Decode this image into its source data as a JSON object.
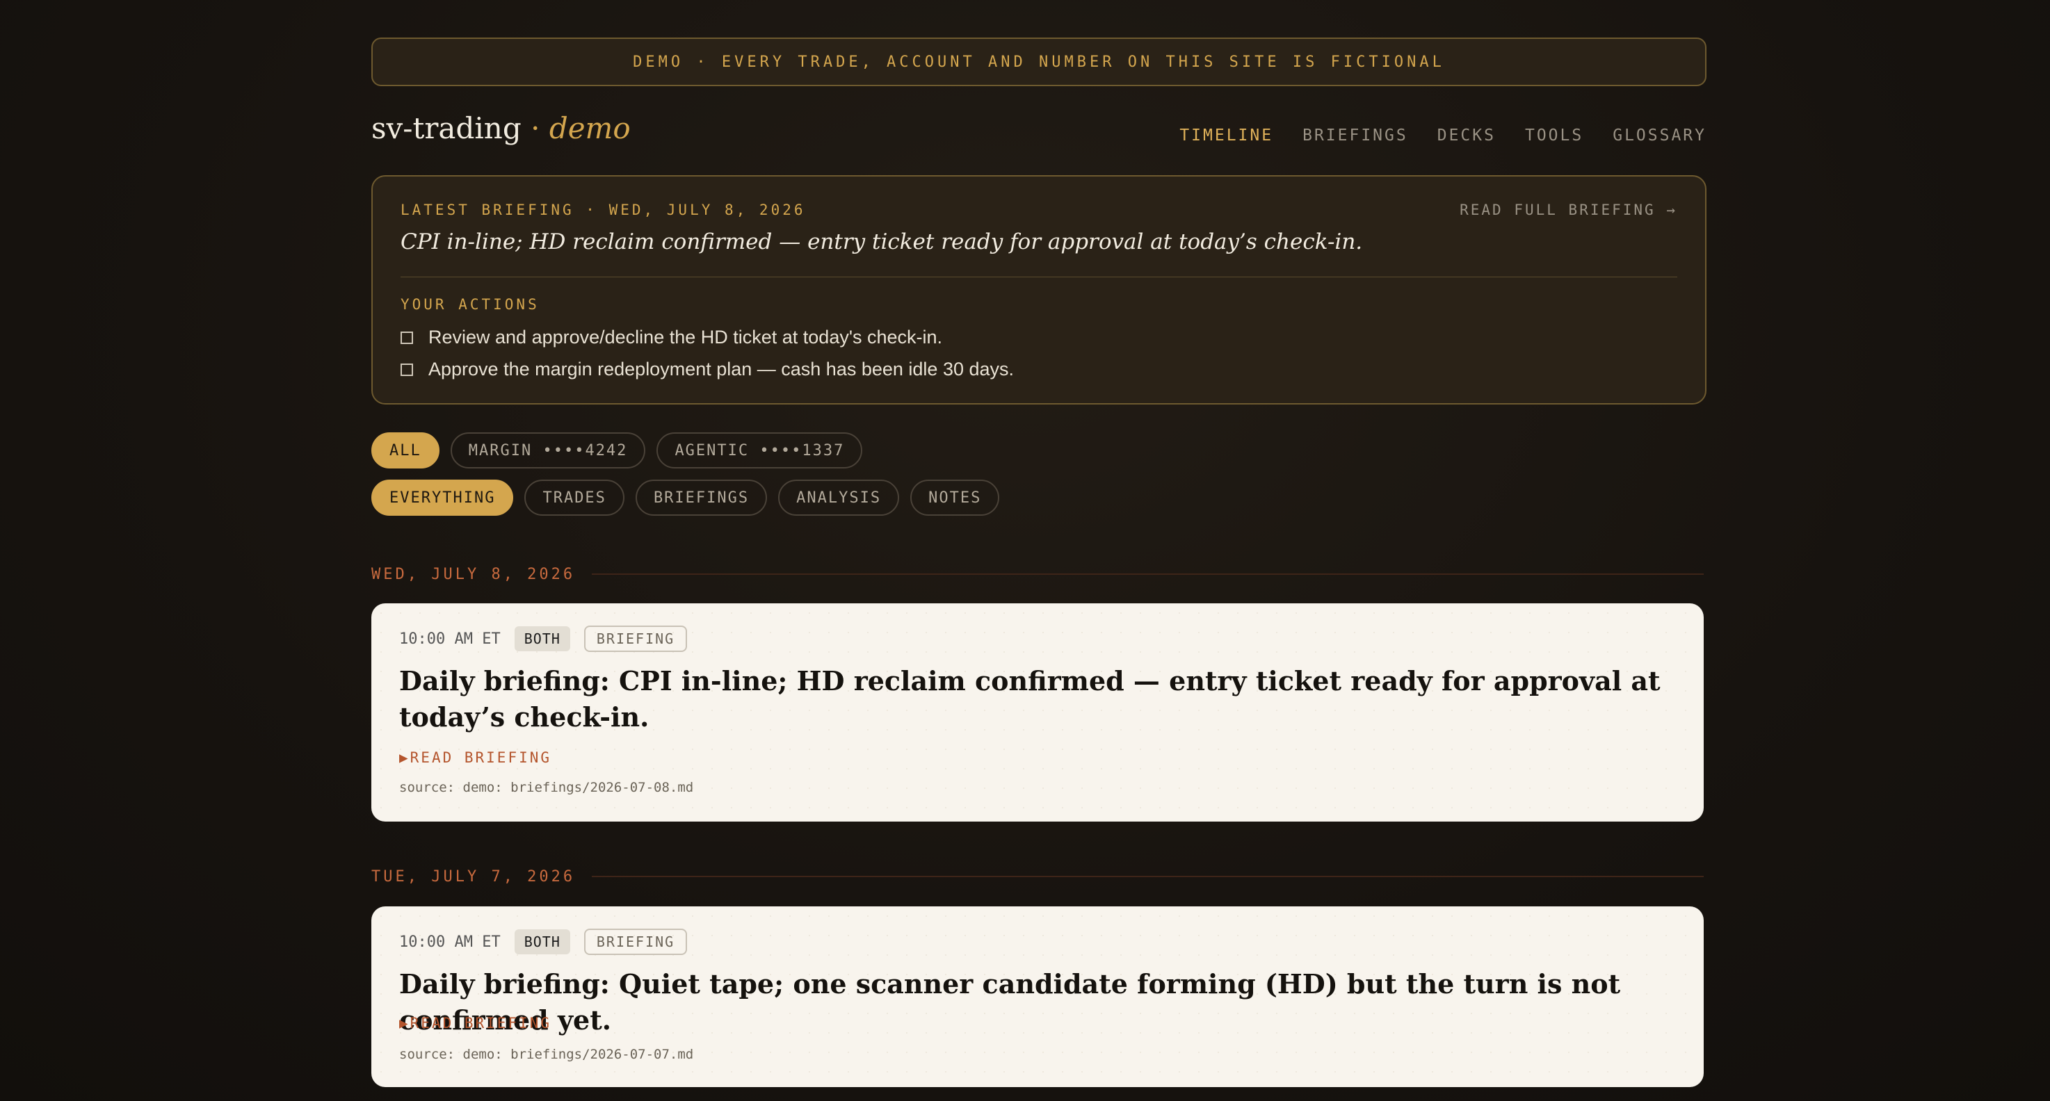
{
  "banner": {
    "text": "DEMO · EVERY TRADE, ACCOUNT AND NUMBER ON THIS SITE IS FICTIONAL"
  },
  "brand": {
    "name": "sv-trading",
    "separator": "·",
    "suffix": "demo"
  },
  "nav": [
    {
      "label": "TIMELINE",
      "active": true
    },
    {
      "label": "BRIEFINGS",
      "active": false
    },
    {
      "label": "DECKS",
      "active": false
    },
    {
      "label": "TOOLS",
      "active": false
    },
    {
      "label": "GLOSSARY",
      "active": false
    }
  ],
  "latest_briefing": {
    "header": "LATEST BRIEFING · WED, JULY 8, 2026",
    "read_full_label": "READ FULL BRIEFING →",
    "summary": "CPI in-line; HD reclaim confirmed — entry ticket ready for approval at today’s check-in.",
    "actions_header": "YOUR ACTIONS",
    "actions": [
      "Review and approve/decline the HD ticket at today's check-in.",
      "Approve the margin redeployment plan — cash has been idle 30 days."
    ]
  },
  "account_filters": [
    {
      "label": "ALL",
      "selected": true
    },
    {
      "label": "MARGIN ••••4242",
      "selected": false
    },
    {
      "label": "AGENTIC ••••1337",
      "selected": false
    }
  ],
  "type_filters": [
    {
      "label": "EVERYTHING",
      "selected": true
    },
    {
      "label": "TRADES",
      "selected": false
    },
    {
      "label": "BRIEFINGS",
      "selected": false
    },
    {
      "label": "ANALYSIS",
      "selected": false
    },
    {
      "label": "NOTES",
      "selected": false
    }
  ],
  "timeline": [
    {
      "date": "WED, JULY 8, 2026",
      "entries": [
        {
          "time": "10:00 AM ET",
          "account_tag": "BOTH",
          "type_tag": "BRIEFING",
          "title": "Daily briefing: CPI in-line; HD reclaim confirmed — entry ticket ready for approval at today’s check-in.",
          "link_label": "READ BRIEFING",
          "source": "source: demo: briefings/2026-07-08.md"
        }
      ]
    },
    {
      "date": "TUE, JULY 7, 2026",
      "entries": [
        {
          "time": "10:00 AM ET",
          "account_tag": "BOTH",
          "type_tag": "BRIEFING",
          "title": "Daily briefing: Quiet tape; one scanner candidate forming (HD) but the turn is not confirmed yet.",
          "link_label": "READ BRIEFING",
          "source": "source: demo: briefings/2026-07-07.md"
        }
      ]
    }
  ],
  "colors": {
    "accent": "#d4a64e",
    "date": "#c86a3e",
    "link": "#b4552d",
    "card": "#f8f4ed"
  }
}
